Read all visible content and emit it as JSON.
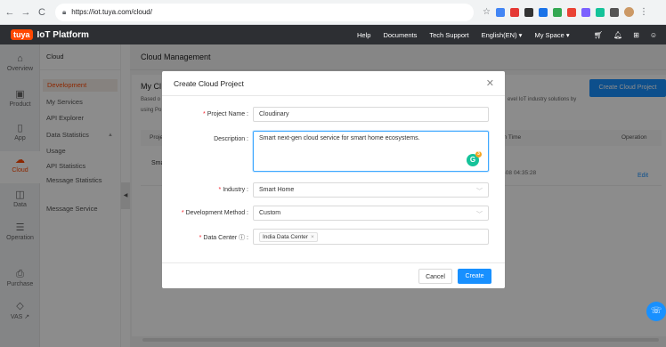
{
  "browser": {
    "url": "https://iot.tuya.com/cloud/",
    "back": "←",
    "forward": "→",
    "reload": "C"
  },
  "topbar": {
    "logo": "tuya",
    "platform": "IoT Platform",
    "menu": [
      "Help",
      "Documents",
      "Tech Support",
      "English(EN) ▾",
      "My Space ▾"
    ],
    "icons": [
      "cart-icon",
      "bell-icon",
      "apps-icon",
      "user-icon"
    ]
  },
  "rail": [
    {
      "icon": "⌂",
      "label": "Overview"
    },
    {
      "icon": "▣",
      "label": "Product"
    },
    {
      "icon": "▯",
      "label": "App"
    },
    {
      "icon": "☁",
      "label": "Cloud"
    },
    {
      "icon": "◫",
      "label": "Data"
    },
    {
      "icon": "☰",
      "label": "Operation"
    },
    {
      "icon": "⎙",
      "label": "Purchase"
    },
    {
      "icon": "◇",
      "label": "VAS ↗"
    }
  ],
  "subnav": {
    "heading": "Cloud",
    "items": [
      "Development",
      "My Services",
      "API Explorer",
      "Data Statistics",
      "Usage",
      "API Statistics",
      "Message Statistics",
      "Message Service"
    ]
  },
  "main": {
    "title": "Cloud Management",
    "heading_partial": "My Cl",
    "desc_left_1": "Based o",
    "desc_left_2": "using Po",
    "desc_right": "evel IoT industry solutions by",
    "create_button": "Create Cloud Project",
    "table": {
      "col_project": "Proje",
      "col_time": "on Time",
      "col_operation": "Operation",
      "row_name": "Sma",
      "row_time": "9-08 04:35:28",
      "row_action": "Edit"
    }
  },
  "dialog": {
    "title": "Create Cloud Project",
    "close": "✕",
    "fields": {
      "project_name": {
        "label": "Project Name",
        "value": "Cloudinary"
      },
      "description": {
        "label": "Description",
        "value": "Smart next-gen cloud service for smart home ecosystems."
      },
      "industry": {
        "label": "Industry",
        "value": "Smart Home"
      },
      "dev_method": {
        "label": "Development Method",
        "value": "Custom"
      },
      "data_center": {
        "label": "Data Center",
        "tag": "India Data Center",
        "tag_remove": "×"
      }
    },
    "cancel": "Cancel",
    "create": "Create"
  },
  "grammarly": {
    "letter": "G",
    "count": "3"
  }
}
